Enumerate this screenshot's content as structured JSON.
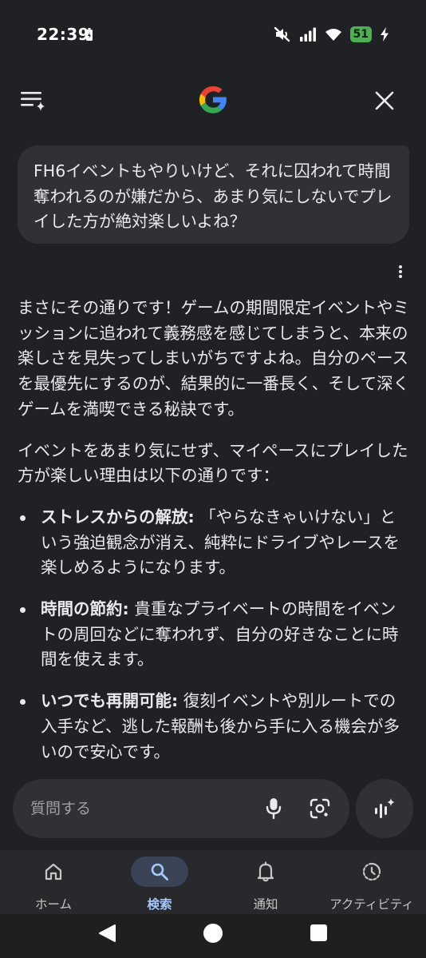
{
  "status_bar": {
    "time": "22:39",
    "battery_level": "51",
    "icons": [
      "charging-icon",
      "mute-icon",
      "signal-icon",
      "wifi-icon",
      "battery-icon",
      "bolt-icon"
    ]
  },
  "app_bar": {
    "logo": "G",
    "icons": [
      "menu-sparkle-icon",
      "google-g-icon",
      "close-icon"
    ]
  },
  "query": {
    "text": "FH6イベントもやりいけど、それに囚われて時間奪われるのが嫌だから、あまり気にしないでプレイした方が絶対楽しいよね？"
  },
  "answer": {
    "paragraphs": [
      "まさにその通りです！ゲームの期間限定イベントやミッションに追われて義務感を感じてしまうと、本来の楽しさを見失ってしまいがちですよね。自分のペースを最優先にするのが、結果的に一番長く、そして深くゲームを満喫できる秘訣です。",
      "イベントをあまり気にせず、マイペースにプレイした方が楽しい理由は以下の通りです："
    ],
    "bullets": [
      {
        "label": "ストレスからの解放:",
        "text": " 「やらなきゃいけない」という強迫観念が消え、純粋にドライブやレースを楽しめるようになります。"
      },
      {
        "label": "時間の節約:",
        "text": " 貴重なプライベートの時間をイベントの周回などに奪われず、自分の好きなことに時間を使えます。"
      },
      {
        "label": "いつでも再開可能:",
        "text": " 復刻イベントや別ルートでの入手など、逃した報酬も後から手に入る機会が多いので安心です。"
      }
    ]
  },
  "ask_bar": {
    "placeholder": "質問する",
    "icons": [
      "mic-icon",
      "lens-icon",
      "live-sparkle-icon"
    ]
  },
  "bottom_nav": {
    "active": "search",
    "items": [
      {
        "id": "home",
        "label": "ホーム",
        "icon": "home-icon"
      },
      {
        "id": "search",
        "label": "検索",
        "icon": "search-icon"
      },
      {
        "id": "notifications",
        "label": "通知",
        "icon": "bell-icon"
      },
      {
        "id": "activity",
        "label": "アクティビティ",
        "icon": "activity-icon"
      }
    ]
  },
  "colors": {
    "background": "#202124",
    "surface": "#303134",
    "nav_background": "#28292c",
    "active_indicator": "#394457",
    "active_label": "#a8c7fa",
    "battery": "#4caf50"
  }
}
